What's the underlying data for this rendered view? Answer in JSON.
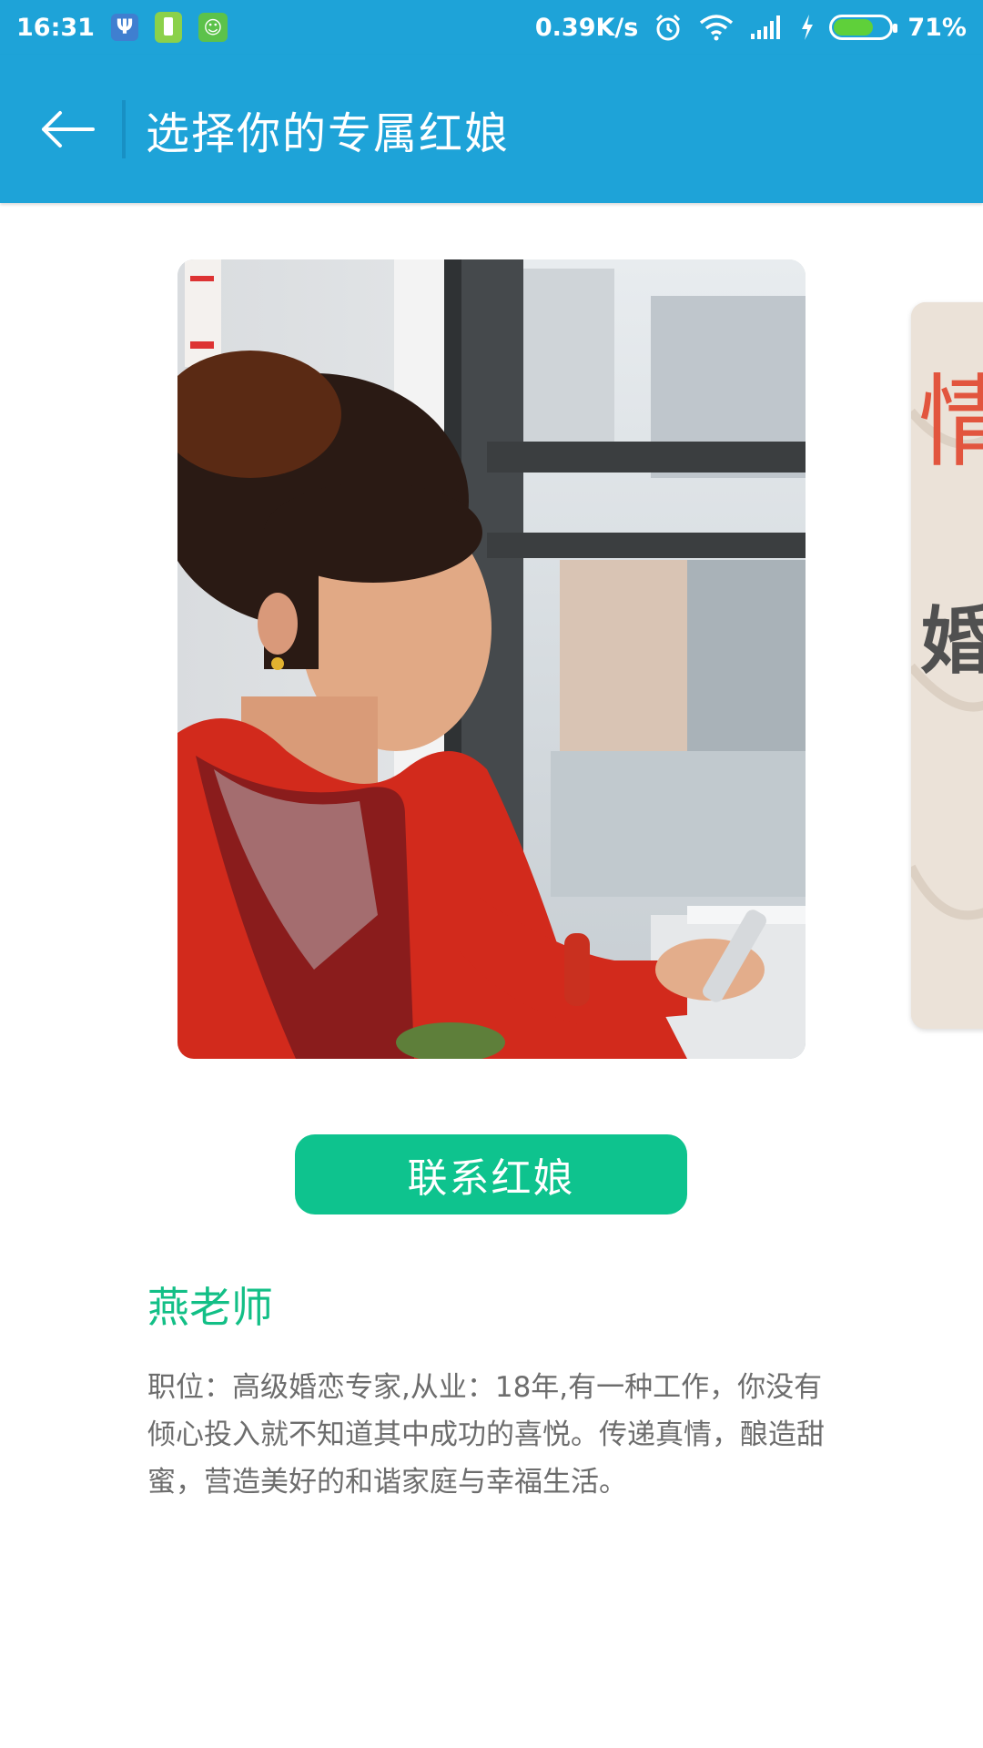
{
  "status_bar": {
    "time": "16:31",
    "net_speed": "0.39K/s",
    "battery_percent": "71%",
    "battery_level": 0.71
  },
  "app_bar": {
    "title": "选择你的专属红娘"
  },
  "carousel": {
    "next_card_text_top": "情",
    "next_card_text_bottom": "婚"
  },
  "contact_button": {
    "label": "联系红娘"
  },
  "matchmaker": {
    "name": "燕老师",
    "description": "职位：高级婚恋专家,从业：18年,有一种工作，你没有倾心投入就不知道其中成功的喜悦。传递真情，酿造甜蜜，营造美好的和谐家庭与幸福生活。"
  },
  "colors": {
    "primary_blue": "#1ea3d8",
    "accent_green": "#0ec38e",
    "name_green": "#12bf86"
  }
}
